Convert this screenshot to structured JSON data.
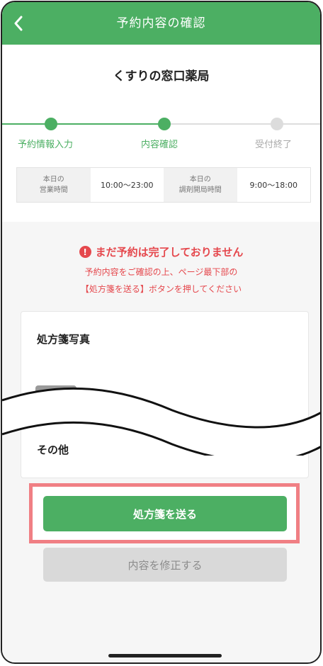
{
  "header": {
    "title": "予約内容の確認"
  },
  "pharmacy": {
    "name": "くすりの窓口薬局"
  },
  "steps": [
    {
      "label": "予約情報入力",
      "state": "done"
    },
    {
      "label": "内容確認",
      "state": "done"
    },
    {
      "label": "受付終了",
      "state": "todo"
    }
  ],
  "hours": {
    "business_label_1": "本日の",
    "business_label_2": "営業時間",
    "business_value": "10:00〜23:00",
    "dispensing_label_1": "本日の",
    "dispensing_label_2": "調剤開局時間",
    "dispensing_value": "9:00〜18:00"
  },
  "notice": {
    "title": "まだ予約は完了しておりません",
    "line1": "予約内容をご確認の上、ページ最下部の",
    "line2": "【処方箋を送る】ボタンを押してください"
  },
  "card": {
    "photo_heading": "処方箋写真",
    "other_heading": "その他"
  },
  "buttons": {
    "send": "処方箋を送る",
    "edit": "内容を修正する"
  },
  "colors": {
    "accent": "#4caf63",
    "warning": "#e5484d",
    "highlight": "#f07f84"
  }
}
